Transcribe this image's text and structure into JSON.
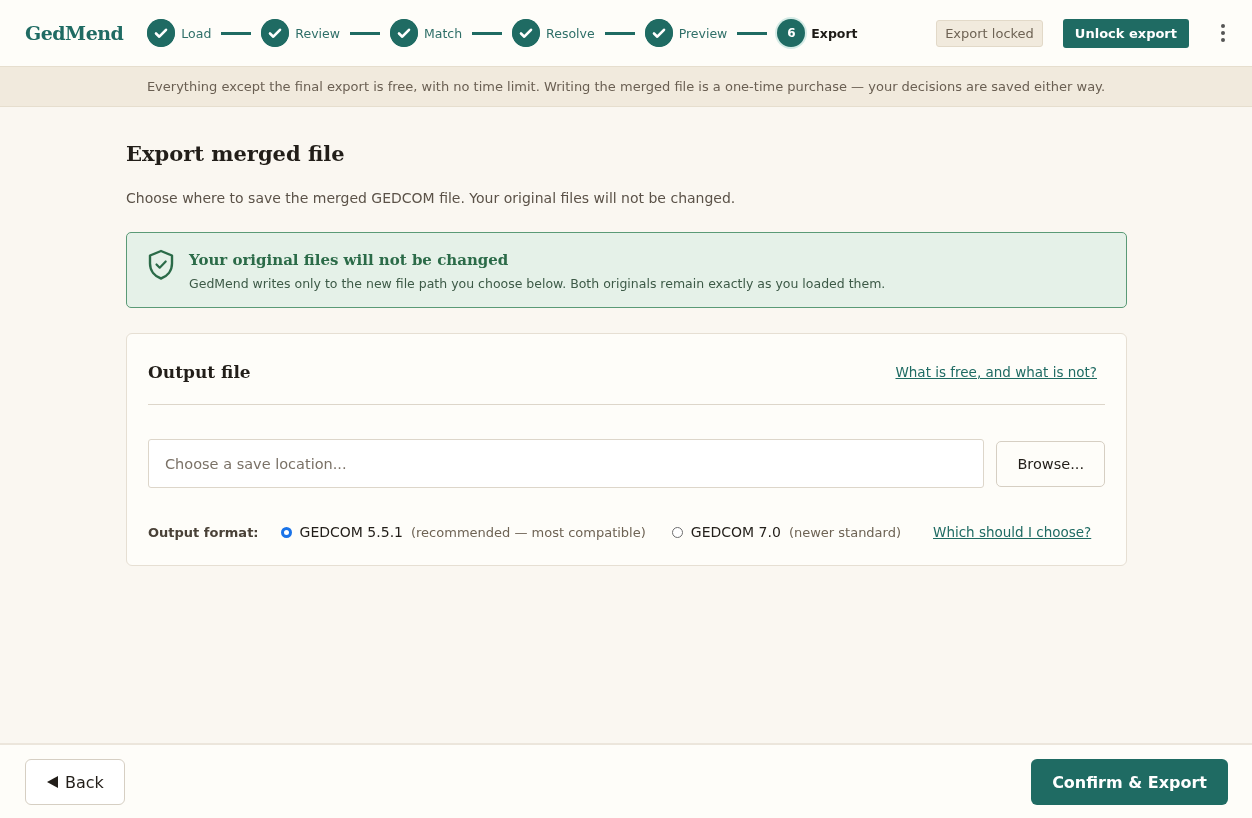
{
  "brand": "GedMend",
  "steps": [
    {
      "label": "Load",
      "done": true,
      "selected": false
    },
    {
      "label": "Review",
      "done": true,
      "selected": false
    },
    {
      "label": "Match",
      "done": true,
      "selected": false
    },
    {
      "label": "Resolve",
      "done": true,
      "selected": false
    },
    {
      "label": "Preview",
      "done": true,
      "selected": false
    },
    {
      "label": "Export",
      "number": "6",
      "done": false,
      "selected": true
    }
  ],
  "status_badge": "Export locked",
  "unlock_button": "Unlock export",
  "banner": "Everything except the final export is free, with no time limit. Writing the merged file is a one-time purchase — your decisions are saved either way.",
  "page": {
    "title": "Export merged file",
    "subtitle": "Choose where to save the merged GEDCOM file. Your original files will not be changed."
  },
  "notice": {
    "title": "Your original files will not be changed",
    "text": "GedMend writes only to the new file path you choose below. Both originals remain exactly as you loaded them."
  },
  "output": {
    "title": "Output file",
    "help_link": "What is free, and what is not?",
    "path_placeholder": "Choose a save location...",
    "browse_button": "Browse...",
    "format_label": "Output format:",
    "formats": [
      {
        "name": "GEDCOM 5.5.1",
        "note": "(recommended — most compatible)",
        "selected": true
      },
      {
        "name": "GEDCOM 7.0",
        "note": "(newer standard)",
        "selected": false
      }
    ],
    "format_help_link": "Which should I choose?"
  },
  "footer": {
    "back_button": "Back",
    "confirm_button": "Confirm & Export"
  }
}
